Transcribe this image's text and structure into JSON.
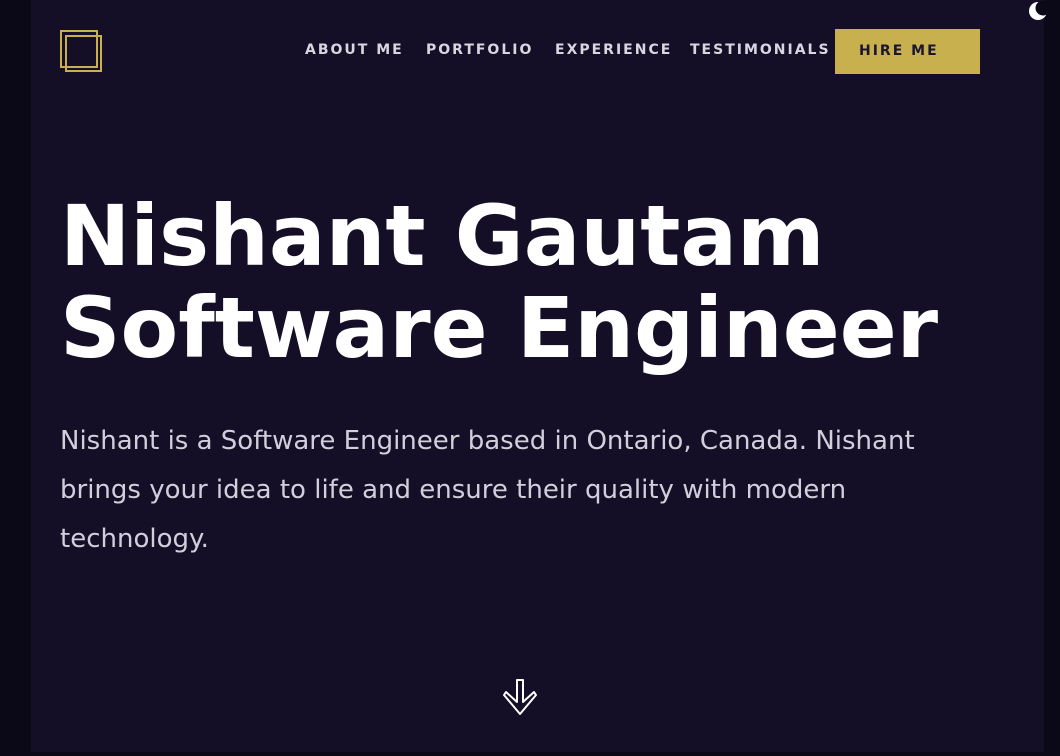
{
  "nav": {
    "items": [
      {
        "label": "ABOUT ME"
      },
      {
        "label": "PORTFOLIO"
      },
      {
        "label": "EXPERIENCE"
      },
      {
        "label": "TESTIMONIALS"
      }
    ],
    "hire_label": "HIRE ME"
  },
  "hero": {
    "name": "Nishant Gautam",
    "role": "Software Engineer",
    "intro": "Nishant is a Software Engineer based in Ontario, Canada. Nishant brings your idea to life and ensure their quality with modern technology."
  },
  "icons": {
    "logo": "logo-squares-icon",
    "theme": "moon-icon",
    "scroll": "arrow-down-icon"
  },
  "colors": {
    "background": "#140f26",
    "accent": "#c9b04f",
    "text": "#ffffff"
  }
}
